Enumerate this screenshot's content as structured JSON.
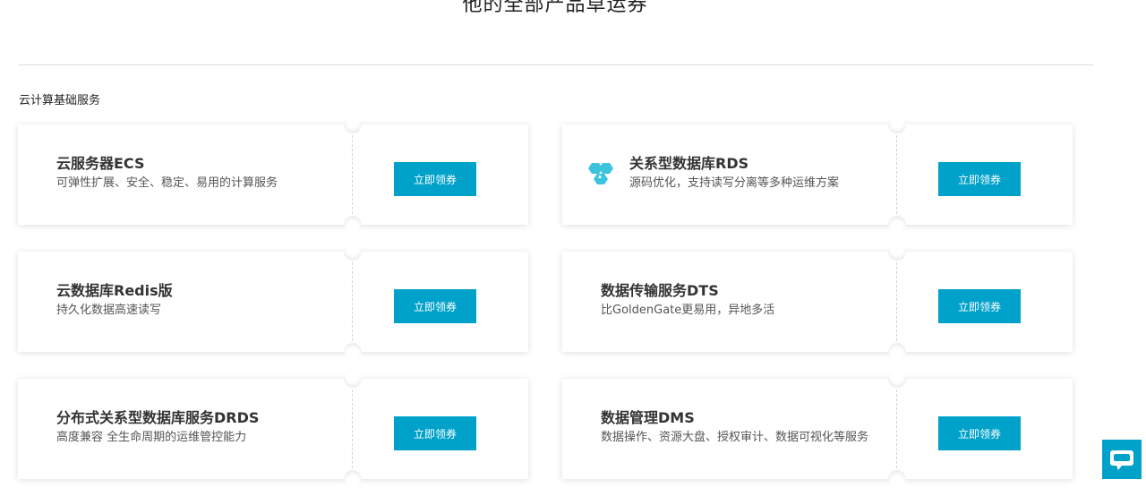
{
  "page": {
    "section_title": "他的全部产品草运券",
    "category_title": "云计算基础服务"
  },
  "cards": [
    {
      "name": "云服务器ECS",
      "desc": "可弹性扩展、安全、稳定、易用的计算服务",
      "button": "立即领券"
    },
    {
      "name": "关系型数据库RDS",
      "desc": "源码优化，支持读写分离等多种运维方案",
      "button": "立即领券",
      "icon": "hexagon-cluster-icon"
    },
    {
      "name": "云数据库Redis版",
      "desc": "持久化数据高速读写",
      "button": "立即领券"
    },
    {
      "name": "数据传输服务DTS",
      "desc": "比GoldenGate更易用，异地多活",
      "button": "立即领券"
    },
    {
      "name": "分布式关系型数据库服务DRDS",
      "desc": "高度兼容 全生命周期的运维管控能力",
      "button": "立即领券"
    },
    {
      "name": "数据管理DMS",
      "desc": "数据操作、资源大盘、授权审计、数据可视化等服务",
      "button": "立即领券"
    }
  ],
  "chat_widget": {
    "icon": "chat-bubble-icon"
  },
  "colors": {
    "accent": "#00a2ca",
    "icon_teal": "#3cc4dc"
  }
}
